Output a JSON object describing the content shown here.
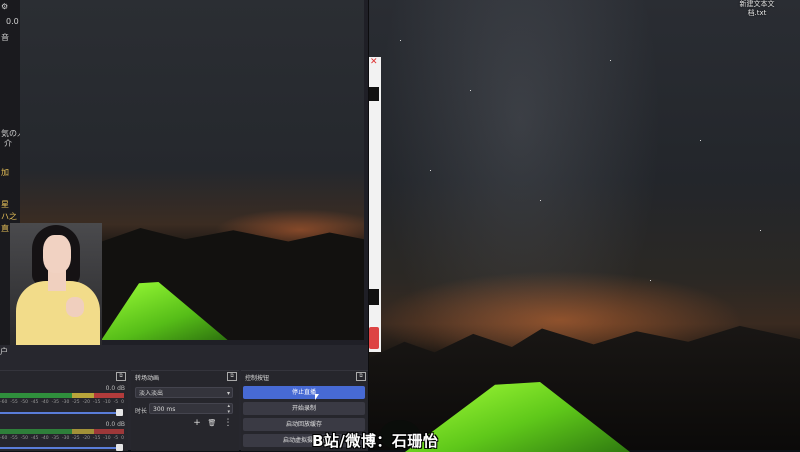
{
  "desktop": {
    "file_name_line1": "新建文本文",
    "file_name_line2": "档.txt"
  },
  "left_dock": {
    "items": [
      "0.0",
      "音",
      "気の人",
      "介",
      "加",
      "星",
      "ハ之",
      "直",
      "户"
    ]
  },
  "mixer": {
    "tracks": [
      {
        "db": "0.0 dB",
        "level": 1.0
      },
      {
        "db": "0.0 dB",
        "level": 1.0
      }
    ],
    "ticks": [
      "-60",
      "-55",
      "-50",
      "-45",
      "-40",
      "-35",
      "-30",
      "-25",
      "-20",
      "-15",
      "-10",
      "-5",
      "0"
    ],
    "colors": {
      "green": "#2f8f3c",
      "yellow": "#b8a43a",
      "red": "#b23b3b",
      "slider": "#5a7dd8"
    }
  },
  "transitions": {
    "title": "转场动画",
    "selected": "淡入淡出",
    "duration_label": "时长",
    "duration_value": "300 ms",
    "add_label": "+",
    "delete_label": "🗑",
    "more_label": "⋮"
  },
  "controls": {
    "title": "控制按钮",
    "buttons": [
      {
        "label": "停止直播",
        "active": true
      },
      {
        "label": "开始录制",
        "active": false
      },
      {
        "label": "启动回放缓存",
        "active": false
      },
      {
        "label": "启动虚拟摄像机",
        "active": false
      }
    ],
    "accent": "#476ad4"
  },
  "watermark": "B站/微博：石珊怡"
}
